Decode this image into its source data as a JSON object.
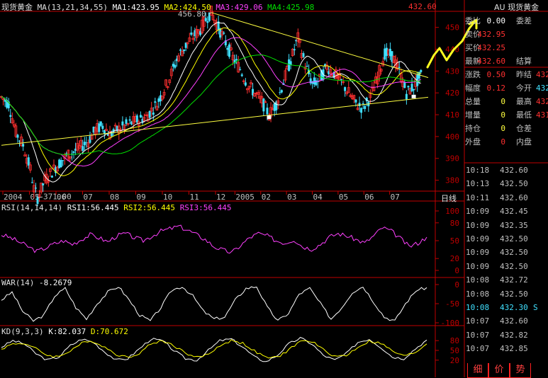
{
  "main_title": "现货黄金",
  "period_label": "日线",
  "ma_line": {
    "params": "MA(13,21,34,55)",
    "ma1": "MA1:423.95",
    "ma2": "MA2:424.50",
    "ma3": "MA3:429.06",
    "ma4": "MA4:425.98",
    "last": "432.60"
  },
  "rsi_header": {
    "params": "RSI(14,14,14)",
    "r1": "RSI1:56.445",
    "r2": "RSI2:56.445",
    "r3": "RSI3:56.445"
  },
  "war_header": {
    "params": "WAR(14)",
    "v": "-8.2679"
  },
  "kd_header": {
    "params": "KD(9,3,3)",
    "k": "K:82.037",
    "d": "D:70.672"
  },
  "colors": {
    "up": "#ff3030",
    "down": "#40e0ff",
    "ma1": "#ffffff",
    "ma2": "#ffff00",
    "ma3": "#ff40ff",
    "ma4": "#00e000",
    "trend": "#ffff40",
    "axis": "#c00000",
    "rsi": "#ff40ff",
    "kd_d": "#ffff00"
  },
  "chart_data": [
    {
      "type": "candlestick",
      "title": "现货黄金",
      "x_labels": [
        "2004",
        "05",
        "06",
        "07",
        "08",
        "09",
        "10",
        "11",
        "12",
        "2005",
        "02",
        "03",
        "04",
        "05",
        "06",
        "07"
      ],
      "y_ticks": [
        "450",
        "440",
        "430",
        "420",
        "410",
        "400",
        "390",
        "380"
      ],
      "ylim": [
        375,
        458
      ],
      "annotations": {
        "high": "456.80",
        "low": "371.00"
      },
      "price_path": [
        {
          "x": 0,
          "y": 418
        },
        {
          "x": 2,
          "y": 415
        },
        {
          "x": 4,
          "y": 402
        },
        {
          "x": 6,
          "y": 396
        },
        {
          "x": 8,
          "y": 385
        },
        {
          "x": 9,
          "y": 376
        },
        {
          "x": 10,
          "y": 372
        },
        {
          "x": 12,
          "y": 380
        },
        {
          "x": 15,
          "y": 386
        },
        {
          "x": 18,
          "y": 391
        },
        {
          "x": 21,
          "y": 394
        },
        {
          "x": 24,
          "y": 398
        },
        {
          "x": 26,
          "y": 403
        },
        {
          "x": 28,
          "y": 405
        },
        {
          "x": 30,
          "y": 401
        },
        {
          "x": 33,
          "y": 404
        },
        {
          "x": 37,
          "y": 407
        },
        {
          "x": 40,
          "y": 409
        },
        {
          "x": 43,
          "y": 415
        },
        {
          "x": 46,
          "y": 425
        },
        {
          "x": 49,
          "y": 437
        },
        {
          "x": 52,
          "y": 444
        },
        {
          "x": 55,
          "y": 449
        },
        {
          "x": 57,
          "y": 455
        },
        {
          "x": 58,
          "y": 456.8
        },
        {
          "x": 60,
          "y": 450
        },
        {
          "x": 62,
          "y": 443
        },
        {
          "x": 64,
          "y": 436
        },
        {
          "x": 66,
          "y": 431
        },
        {
          "x": 68,
          "y": 424
        },
        {
          "x": 70,
          "y": 420
        },
        {
          "x": 72,
          "y": 416
        },
        {
          "x": 74,
          "y": 410
        },
        {
          "x": 76,
          "y": 415
        },
        {
          "x": 78,
          "y": 425
        },
        {
          "x": 80,
          "y": 435
        },
        {
          "x": 82,
          "y": 445
        },
        {
          "x": 84,
          "y": 433
        },
        {
          "x": 86,
          "y": 424
        },
        {
          "x": 88,
          "y": 426
        },
        {
          "x": 90,
          "y": 432
        },
        {
          "x": 92,
          "y": 429
        },
        {
          "x": 94,
          "y": 425
        },
        {
          "x": 96,
          "y": 420
        },
        {
          "x": 98,
          "y": 415
        },
        {
          "x": 100,
          "y": 413
        },
        {
          "x": 102,
          "y": 418
        },
        {
          "x": 104,
          "y": 427
        },
        {
          "x": 106,
          "y": 438
        },
        {
          "x": 108,
          "y": 437
        },
        {
          "x": 110,
          "y": 430
        },
        {
          "x": 112,
          "y": 420
        },
        {
          "x": 114,
          "y": 423
        },
        {
          "x": 116,
          "y": 428
        }
      ],
      "trend_lines": [
        {
          "from": {
            "x": 58,
            "y": 456.8
          },
          "to": {
            "x": 118,
            "y": 427
          }
        },
        {
          "from": {
            "x": 0,
            "y": 396
          },
          "to": {
            "x": 118,
            "y": 418
          }
        }
      ],
      "markers": [
        {
          "x": 74,
          "y": 409
        },
        {
          "x": 114,
          "y": 418.5
        }
      ],
      "last_price": 432.6
    },
    {
      "type": "line",
      "title": "RSI(14,14,14)",
      "y_ticks": [
        "100",
        "80",
        "50",
        "20",
        "0"
      ],
      "ylim": [
        0,
        100
      ],
      "series": [
        {
          "name": "RSI3",
          "values": [
            60,
            55,
            48,
            40,
            32,
            38,
            45,
            50,
            44,
            52,
            60,
            55,
            48,
            58,
            62,
            55,
            50,
            58,
            66,
            70,
            74,
            68,
            60,
            52,
            40,
            34,
            30,
            42,
            55,
            62,
            58,
            50,
            46,
            52,
            40,
            36,
            44,
            56,
            62,
            58,
            52,
            46,
            58,
            72,
            66,
            54,
            40,
            46,
            56
          ]
        }
      ]
    },
    {
      "type": "line",
      "title": "WAR(14)",
      "y_ticks": [
        "0",
        "-50",
        "-100"
      ],
      "ylim": [
        -100,
        0
      ],
      "series": [
        {
          "name": "WAR",
          "values": [
            -40,
            -20,
            -70,
            -95,
            -80,
            -30,
            -10,
            -60,
            -90,
            -50,
            -20,
            -5,
            -40,
            -80,
            -95,
            -60,
            -15,
            -5,
            -30,
            -70,
            -90,
            -85,
            -40,
            -10,
            -5,
            -60,
            -95,
            -75,
            -25,
            -10,
            -50,
            -90,
            -60,
            -20,
            -5,
            -45,
            -85,
            -95,
            -50,
            -15,
            -8
          ]
        }
      ]
    },
    {
      "type": "line",
      "title": "KD(9,3,3)",
      "y_ticks": [
        "80",
        "50",
        "20"
      ],
      "ylim": [
        0,
        100
      ],
      "series": [
        {
          "name": "K",
          "values": [
            60,
            80,
            70,
            40,
            20,
            30,
            65,
            85,
            75,
            45,
            20,
            25,
            55,
            85,
            80,
            50,
            25,
            20,
            50,
            80,
            85,
            60,
            30,
            15,
            35,
            70,
            88,
            70,
            35,
            20,
            40,
            75,
            85,
            60,
            30,
            25,
            55,
            82
          ]
        },
        {
          "name": "D",
          "values": [
            55,
            70,
            72,
            55,
            35,
            30,
            50,
            72,
            78,
            60,
            38,
            28,
            42,
            70,
            80,
            65,
            42,
            28,
            38,
            65,
            80,
            72,
            48,
            28,
            28,
            52,
            78,
            78,
            52,
            32,
            34,
            60,
            78,
            72,
            48,
            32,
            44,
            70
          ]
        }
      ]
    }
  ],
  "panel": {
    "header": "AU 现货黄金",
    "rows": [
      {
        "l": "委比",
        "v": "0.00",
        "l2": "委差",
        "color": "#ffffff"
      },
      {
        "l": "卖价",
        "v": "432.95",
        "l2": "",
        "color": "#ff3030"
      },
      {
        "l": "买价",
        "v": "432.25",
        "l2": "",
        "color": "#ff3030"
      },
      {
        "l": "最新",
        "v": "432.60",
        "l2": "结算",
        "color": "#ff3030"
      },
      {
        "l": "涨跌",
        "v": "0.50",
        "l2": "昨结",
        "color": "#ff3030"
      },
      {
        "l": "幅度",
        "v": "0.12",
        "l2": "今开",
        "color": "#ff3030"
      },
      {
        "l": "总量",
        "v": "0",
        "l2": "最高",
        "color": "#ffff40"
      },
      {
        "l": "增量",
        "v": "0",
        "l2": "最低",
        "color": "#ffff40"
      },
      {
        "l": "持仓",
        "v": "0",
        "l2": "仓差",
        "color": "#ffff40"
      },
      {
        "l": "外盘",
        "v": "0",
        "l2": "内盘",
        "color": "#ff3030"
      }
    ],
    "right_clipped": [
      "",
      "",
      "",
      "",
      "432",
      "432",
      "432",
      "431",
      "",
      ""
    ],
    "ticks": [
      {
        "t": "10:18",
        "p": "432.60",
        "f": ""
      },
      {
        "t": "10:13",
        "p": "432.50",
        "f": ""
      },
      {
        "t": "10:11",
        "p": "432.60",
        "f": ""
      },
      {
        "t": "10:09",
        "p": "432.45",
        "f": ""
      },
      {
        "t": "10:09",
        "p": "432.35",
        "f": ""
      },
      {
        "t": "10:09",
        "p": "432.50",
        "f": ""
      },
      {
        "t": "10:09",
        "p": "432.50",
        "f": ""
      },
      {
        "t": "10:09",
        "p": "432.50",
        "f": ""
      },
      {
        "t": "10:08",
        "p": "432.72",
        "f": ""
      },
      {
        "t": "10:08",
        "p": "432.50",
        "f": ""
      },
      {
        "t": "10:08",
        "p": "432.30",
        "f": "S"
      },
      {
        "t": "10:07",
        "p": "432.60",
        "f": ""
      },
      {
        "t": "10:07",
        "p": "432.82",
        "f": ""
      },
      {
        "t": "10:07",
        "p": "432.85",
        "f": ""
      }
    ],
    "tabs": [
      "细",
      "价",
      "势"
    ]
  }
}
